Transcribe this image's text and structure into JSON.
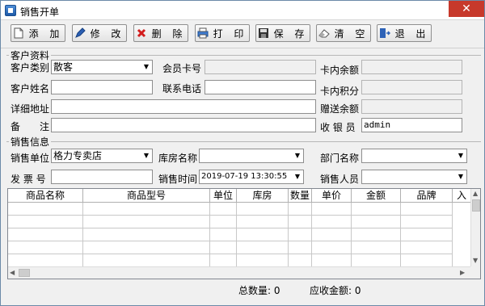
{
  "window": {
    "title": "销售开单",
    "close_glyph": "✕"
  },
  "toolbar": {
    "add": "添 加",
    "edit": "修 改",
    "delete": "删 除",
    "print": "打 印",
    "save": "保 存",
    "clear": "清 空",
    "exit": "退 出"
  },
  "customer": {
    "section_title": "客户资料",
    "type_label": "客户类别",
    "type_value": "散客",
    "card_label": "会员卡号",
    "card_value": "",
    "balance_label": "卡内余额",
    "balance_value": "",
    "name_label": "客户姓名",
    "name_value": "",
    "phone_label": "联系电话",
    "phone_value": "",
    "points_label": "卡内积分",
    "points_value": "",
    "address_label": "详细地址",
    "address_value": "",
    "gift_label": "赠送余额",
    "gift_value": "",
    "remark_label": "备　　注",
    "remark_value": "",
    "cashier_label": "收 银 员",
    "cashier_value": "admin"
  },
  "sales": {
    "section_title": "销售信息",
    "unit_label": "销售单位",
    "unit_value": "格力专卖店",
    "warehouse_label": "库房名称",
    "warehouse_value": "",
    "dept_label": "部门名称",
    "dept_value": "",
    "invoice_label": "发 票 号",
    "invoice_value": "",
    "time_label": "销售时间",
    "time_value": "2019-07-19 13:30:55",
    "staff_label": "销售人员",
    "staff_value": ""
  },
  "grid": {
    "columns": [
      "商品名称",
      "商品型号",
      "单位",
      "库房",
      "数量",
      "单价",
      "金额",
      "品牌",
      "入"
    ]
  },
  "footer": {
    "total_qty": "总数量: 0",
    "total_due": "应收金额: 0"
  },
  "colors": {
    "close_bg": "#c7392b",
    "window_bg": "#f0f0f0"
  }
}
